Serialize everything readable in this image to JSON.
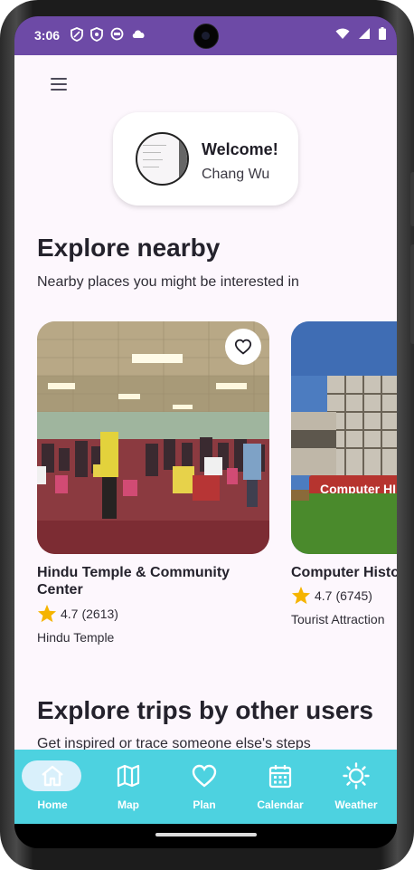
{
  "status_bar": {
    "time": "3:06",
    "left_icons": [
      "shield-icon",
      "shield-icon",
      "face-icon",
      "cloud-icon"
    ],
    "right_icons": [
      "wifi-icon",
      "signal-icon",
      "battery-icon"
    ]
  },
  "header": {
    "menu_icon": "hamburger-menu-icon"
  },
  "welcome": {
    "title": "Welcome!",
    "name": "Chang Wu"
  },
  "explore_nearby": {
    "title": "Explore nearby",
    "subtitle": "Nearby places you might be interested in",
    "places": [
      {
        "name": "Hindu Temple & Community Center",
        "rating": "4.7",
        "reviews": "(2613)",
        "type": "Hindu Temple"
      },
      {
        "name": "Computer History Museum",
        "rating": "4.7",
        "reviews": "(6745)",
        "type": "Tourist Attraction",
        "sign_text": "Computer HI"
      }
    ]
  },
  "explore_trips": {
    "title": "Explore trips by other users",
    "subtitle": "Get inspired or trace someone else's steps"
  },
  "bottom_nav": {
    "items": [
      {
        "label": "Home",
        "icon": "home-icon",
        "active": true
      },
      {
        "label": "Map",
        "icon": "map-icon",
        "active": false
      },
      {
        "label": "Plan",
        "icon": "heart-icon",
        "active": false
      },
      {
        "label": "Calendar",
        "icon": "calendar-icon",
        "active": false
      },
      {
        "label": "Weather",
        "icon": "sun-icon",
        "active": false
      }
    ]
  },
  "colors": {
    "status_bar": "#6d4aa6",
    "background": "#fdf7fd",
    "bottom_nav": "#4dd2e0",
    "active_pill": "#d9f0fb",
    "star": "#f5b400"
  }
}
